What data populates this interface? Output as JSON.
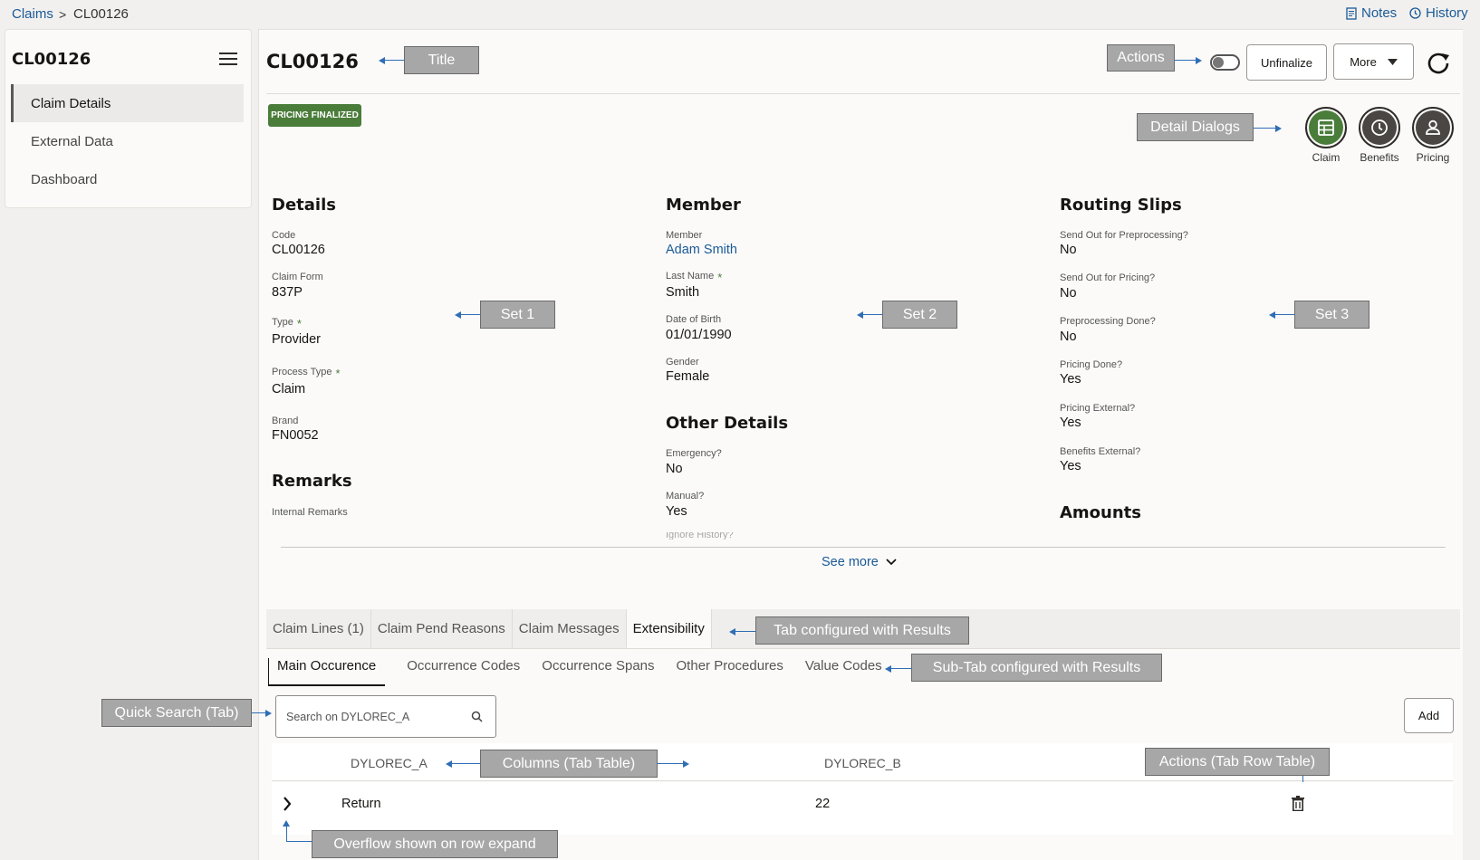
{
  "breadcrumb": {
    "root": "Claims",
    "sep": ">",
    "current": "CL00126"
  },
  "toplinks": {
    "notes": "Notes",
    "history": "History"
  },
  "sidebar": {
    "title": "CL00126",
    "items": [
      {
        "label": "Claim Details",
        "active": true
      },
      {
        "label": "External Data"
      },
      {
        "label": "Dashboard"
      }
    ]
  },
  "header": {
    "title": "CL00126",
    "badge": "PRICING FINALIZED",
    "unfinalize": "Unfinalize",
    "more": "More"
  },
  "dialogs": [
    {
      "label": "Claim",
      "icon": "table-icon"
    },
    {
      "label": "Benefits",
      "icon": "clock-icon"
    },
    {
      "label": "Pricing",
      "icon": "person-icon"
    }
  ],
  "callouts": {
    "title": "Title",
    "actions": "Actions",
    "detail_dialogs": "Detail Dialogs",
    "set1": "Set 1",
    "set2": "Set 2",
    "set3": "Set 3",
    "tab_results": "Tab configured with Results",
    "subtab_results": "Sub-Tab configured with Results",
    "quick_search": "Quick Search (Tab)",
    "columns": "Columns (Tab Table)",
    "row_actions": "Actions (Tab Row Table)",
    "overflow": "Overflow shown on row expand"
  },
  "details": {
    "heading": "Details",
    "fields": [
      {
        "label": "Code",
        "value": "CL00126"
      },
      {
        "label": "Claim Form",
        "value": "837P"
      },
      {
        "label": "Type",
        "value": "Provider"
      },
      {
        "label": "Process Type",
        "value": "Claim"
      },
      {
        "label": "Brand",
        "value": "FN0052"
      }
    ],
    "remarks_heading": "Remarks",
    "internal_remarks": "Internal Remarks"
  },
  "member": {
    "heading": "Member",
    "fields": [
      {
        "label": "Member",
        "value": "Adam Smith"
      },
      {
        "label": "Last Name",
        "value": "Smith"
      },
      {
        "label": "Date of Birth",
        "value": "01/01/1990"
      },
      {
        "label": "Gender",
        "value": "Female"
      }
    ],
    "other_heading": "Other Details",
    "other_fields": [
      {
        "label": "Emergency?",
        "value": "No"
      },
      {
        "label": "Manual?",
        "value": "Yes"
      }
    ],
    "cut_label": "Ignore History?"
  },
  "routing": {
    "heading": "Routing Slips",
    "fields": [
      {
        "label": "Send Out for Preprocessing?",
        "value": "No"
      },
      {
        "label": "Send Out for Pricing?",
        "value": "No"
      },
      {
        "label": "Preprocessing Done?",
        "value": "No"
      },
      {
        "label": "Pricing Done?",
        "value": "Yes"
      },
      {
        "label": "Pricing External?",
        "value": "Yes"
      },
      {
        "label": "Benefits External?",
        "value": "Yes"
      }
    ],
    "amounts_heading": "Amounts"
  },
  "see_more": "See more",
  "tabs": [
    "Claim Lines (1)",
    "Claim Pend Reasons",
    "Claim Messages",
    "Extensibility"
  ],
  "subtabs": [
    "Main Occurence",
    "Occurrence Codes",
    "Occurrence Spans",
    "Other Procedures",
    "Value Codes"
  ],
  "search": {
    "placeholder": "Search on DYLOREC_A"
  },
  "add_label": "Add",
  "table": {
    "columns": [
      "DYLOREC_A",
      "DYLOREC_B"
    ],
    "rows": [
      {
        "a": "Return",
        "b": "22"
      }
    ]
  }
}
